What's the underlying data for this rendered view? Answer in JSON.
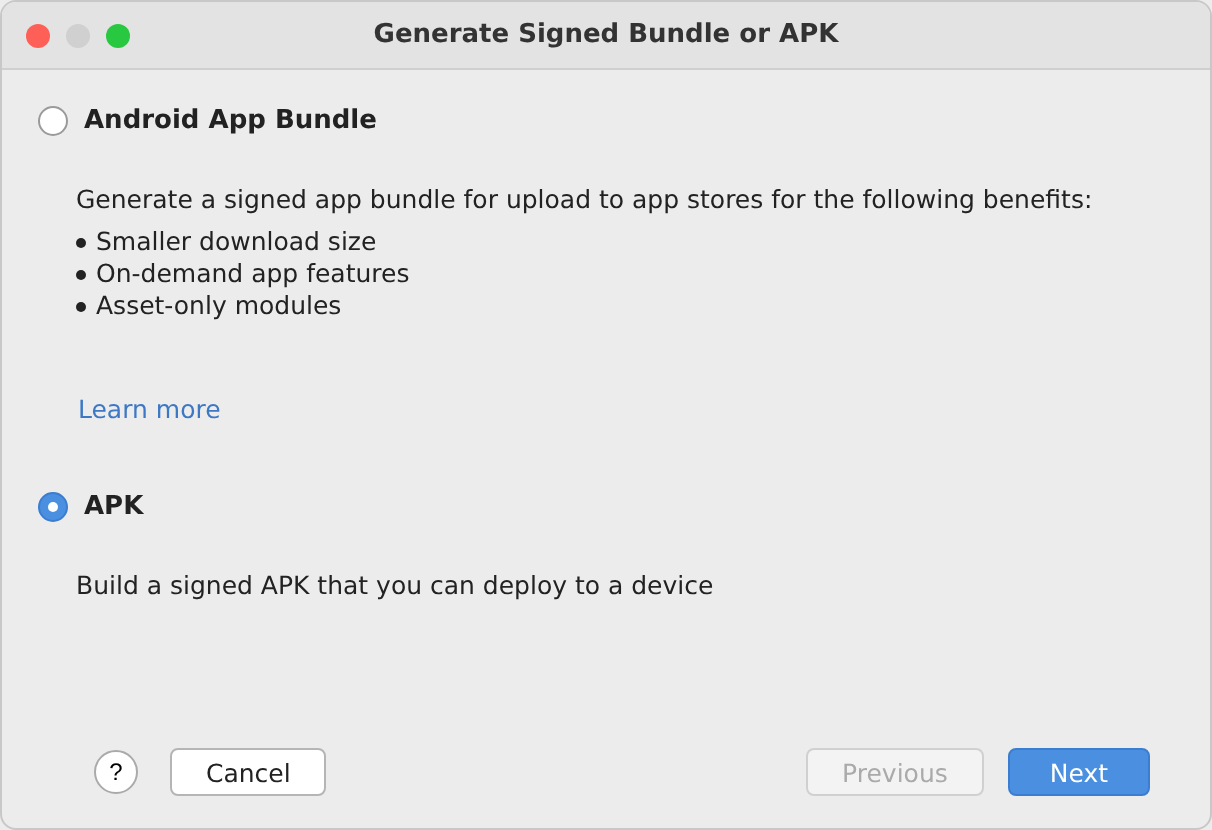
{
  "window": {
    "title": "Generate Signed Bundle or APK"
  },
  "options": [
    {
      "label": "Android App Bundle",
      "selected": false,
      "description": "Generate a signed app bundle for upload to app stores for the following benefits:",
      "bullets": [
        "Smaller download size",
        "On-demand app features",
        "Asset-only modules"
      ],
      "link": "Learn more"
    },
    {
      "label": "APK",
      "selected": true,
      "description": "Build a signed APK that you can deploy to a device"
    }
  ],
  "buttons": [
    {
      "label": "Cancel",
      "kind": "normal",
      "disabled": false
    },
    {
      "label": "Previous",
      "kind": "normal",
      "disabled": true
    },
    {
      "label": "Next",
      "kind": "default",
      "disabled": false
    }
  ],
  "help": {
    "label": "?"
  }
}
